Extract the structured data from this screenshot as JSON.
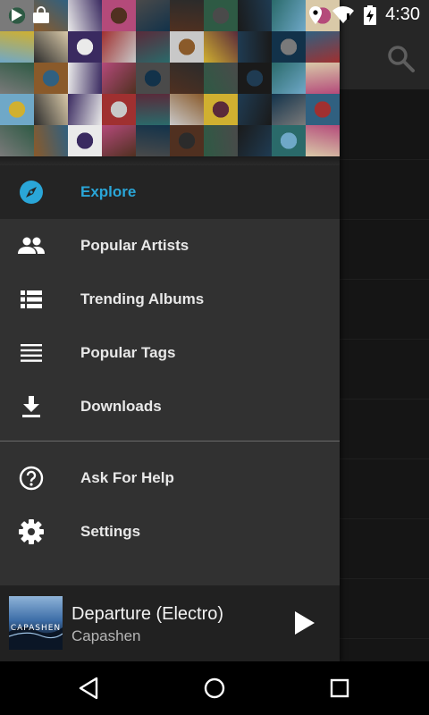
{
  "status_bar": {
    "time": "4:30",
    "icons": [
      "play-icon",
      "shopping-bag-icon",
      "location-icon",
      "wifi-icon",
      "battery-charging-icon"
    ]
  },
  "toolbar": {
    "search_icon": "search-icon"
  },
  "drawer": {
    "header_icon": "album-mosaic",
    "items": [
      {
        "label": "Explore",
        "icon": "compass-icon",
        "active": true
      },
      {
        "label": "Popular Artists",
        "icon": "people-icon",
        "active": false
      },
      {
        "label": "Trending Albums",
        "icon": "list-view-icon",
        "active": false
      },
      {
        "label": "Popular Tags",
        "icon": "lines-icon",
        "active": false
      },
      {
        "label": "Downloads",
        "icon": "download-icon",
        "active": false
      },
      {
        "label": "Ask For Help",
        "icon": "help-icon",
        "active": false
      },
      {
        "label": "Settings",
        "icon": "gear-icon",
        "active": false
      }
    ]
  },
  "player": {
    "title": "Departure (Electro)",
    "artist": "Capashen",
    "art_text": "CAPASHEN",
    "play_icon": "play-icon"
  },
  "colors": {
    "accent": "#2aa6d8",
    "drawer_bg": "#313131",
    "active_bg": "#242424"
  }
}
